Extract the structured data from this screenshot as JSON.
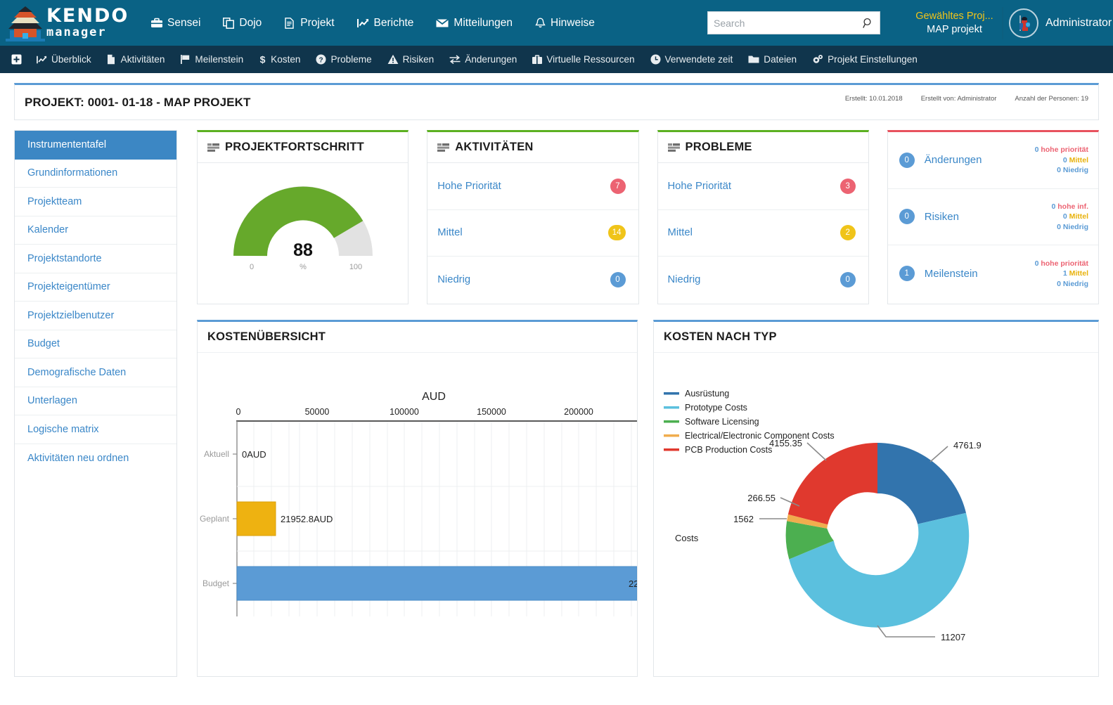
{
  "topbar": {
    "logo": {
      "line1": "KENDO",
      "line2": "manager",
      "icon": "pagoda-logo"
    },
    "nav": [
      {
        "label": "Sensei",
        "icon": "briefcase-icon"
      },
      {
        "label": "Dojo",
        "icon": "copy-icon"
      },
      {
        "label": "Projekt",
        "icon": "file-text-icon"
      },
      {
        "label": "Berichte",
        "icon": "chart-line-icon"
      },
      {
        "label": "Mitteilungen",
        "icon": "envelope-icon"
      },
      {
        "label": "Hinweise",
        "icon": "bell-icon"
      }
    ],
    "search": {
      "value": "",
      "placeholder": "Search",
      "icon": "search-icon"
    },
    "selected_project": {
      "label": "Gewähltes Proj...",
      "value": "MAP projekt"
    },
    "user": {
      "name": "Administrator",
      "avatar": "samurai-avatar"
    }
  },
  "subnav": {
    "plus_icon": "plus-square-icon",
    "items": [
      {
        "label": "Überblick",
        "icon": "chart-line-icon"
      },
      {
        "label": "Aktivitäten",
        "icon": "file-copy-icon"
      },
      {
        "label": "Meilenstein",
        "icon": "flag-icon"
      },
      {
        "label": "Kosten",
        "icon": "dollar-icon"
      },
      {
        "label": "Probleme",
        "icon": "question-circle-icon"
      },
      {
        "label": "Risiken",
        "icon": "warning-triangle-icon"
      },
      {
        "label": "Änderungen",
        "icon": "exchange-icon"
      },
      {
        "label": "Virtuelle Ressourcen",
        "icon": "briefcase-icon"
      },
      {
        "label": "Verwendete zeit",
        "icon": "clock-icon"
      },
      {
        "label": "Dateien",
        "icon": "folder-icon"
      },
      {
        "label": "Projekt Einstellungen",
        "icon": "gears-icon"
      }
    ]
  },
  "project_header": {
    "title": "PROJEKT: 0001- 01-18 - MAP PROJEKT",
    "meta": [
      "Erstellt: 10.01.2018",
      "Erstellt von: Administrator",
      "Anzahl der Personen: 19"
    ]
  },
  "sidebar": {
    "items": [
      {
        "label": "Instrumententafel",
        "active": true
      },
      {
        "label": "Grundinformationen",
        "active": false
      },
      {
        "label": "Projektteam",
        "active": false
      },
      {
        "label": "Kalender",
        "active": false
      },
      {
        "label": "Projektstandorte",
        "active": false
      },
      {
        "label": "Projekteigentümer",
        "active": false
      },
      {
        "label": "Projektzielbenutzer",
        "active": false
      },
      {
        "label": "Budget",
        "active": false
      },
      {
        "label": "Demografische Daten",
        "active": false
      },
      {
        "label": "Unterlagen",
        "active": false
      },
      {
        "label": "Logische matrix",
        "active": false
      },
      {
        "label": "Aktivitäten neu ordnen",
        "active": false
      }
    ]
  },
  "progress_card": {
    "title": "PROJEKTFORTSCHRITT",
    "icon": "list-icon",
    "gauge": {
      "value": 88,
      "min_label": "0",
      "max_label": "100",
      "unit_label": "%"
    }
  },
  "activities_card": {
    "title": "AKTIVITÄTEN",
    "icon": "list-icon",
    "rows": [
      {
        "label": "Hohe Priorität",
        "count": "7",
        "color": "red"
      },
      {
        "label": "Mittel",
        "count": "14",
        "color": "yellow"
      },
      {
        "label": "Niedrig",
        "count": "0",
        "color": "blue"
      }
    ]
  },
  "issues_card": {
    "title": "PROBLEME",
    "icon": "list-icon",
    "rows": [
      {
        "label": "Hohe Priorität",
        "count": "3",
        "color": "red"
      },
      {
        "label": "Mittel",
        "count": "2",
        "color": "yellow"
      },
      {
        "label": "Niedrig",
        "count": "0",
        "color": "blue"
      }
    ]
  },
  "summary_card": {
    "rows": [
      {
        "count": "0",
        "name": "Änderungen",
        "stats": [
          {
            "num": "0",
            "text": "hohe priorität",
            "level": "high"
          },
          {
            "num": "0",
            "text": "Mittel",
            "level": "mid"
          },
          {
            "num": "0",
            "text": "Niedrig",
            "level": "low"
          }
        ]
      },
      {
        "count": "0",
        "name": "Risiken",
        "stats": [
          {
            "num": "0",
            "text": "hohe inf.",
            "level": "high"
          },
          {
            "num": "0",
            "text": "Mittel",
            "level": "mid"
          },
          {
            "num": "0",
            "text": "Niedrig",
            "level": "low"
          }
        ]
      },
      {
        "count": "1",
        "name": "Meilenstein",
        "stats": [
          {
            "num": "0",
            "text": "hohe priorität",
            "level": "high"
          },
          {
            "num": "1",
            "text": "Mittel",
            "level": "mid"
          },
          {
            "num": "0",
            "text": "Niedrig",
            "level": "low"
          }
        ]
      }
    ]
  },
  "cost_card": {
    "title": "KOSTENÜBERSICHT"
  },
  "type_card": {
    "title": "KOSTEN NACH TYP"
  },
  "chart_data": [
    {
      "type": "bar",
      "orientation": "horizontal",
      "title": "KOSTENÜBERSICHT",
      "xlabel": "AUD",
      "ylabel": "",
      "categories": [
        "Aktuell",
        "Geplant",
        "Budget"
      ],
      "values": [
        0,
        21952.8,
        224000
      ],
      "data_labels": [
        "0AUD",
        "21952.8AUD",
        "22"
      ],
      "colors": [
        "#f0b400",
        "#f0b400",
        "#5b9bd5"
      ],
      "xlim": [
        0,
        224000
      ],
      "xticks": [
        0,
        50000,
        100000,
        150000,
        200000
      ],
      "xtick_labels": [
        "0",
        "50000",
        "100000",
        "150000",
        "200000"
      ],
      "grid": true,
      "note": "Budget bar is clipped at the panel edge; its label is truncated to '22'"
    },
    {
      "type": "pie",
      "variant": "donut",
      "title": "KOSTEN NACH TYP",
      "axis_label": "Costs",
      "labels": [
        "Ausrüstung",
        "Prototype Costs",
        "Software Licensing",
        "Electrical/Electronic Component Costs",
        "PCB Production Costs"
      ],
      "values": [
        4761.9,
        11207,
        1562,
        266.55,
        4155.35
      ],
      "value_labels": [
        "4761.9",
        "11207",
        "1562",
        "266.55",
        "4155.35"
      ],
      "colors": [
        "#3274ad",
        "#5bc0de",
        "#4caf50",
        "#f0ad4e",
        "#e0392e"
      ],
      "legend": "left",
      "grid": false
    }
  ],
  "colors": {
    "brand_blue": "#0a6285",
    "subnav_dark": "#10354c",
    "accent_yellow": "#f0c419",
    "link_blue": "#3a87c8",
    "green": "#5cb021",
    "red": "#e8525e"
  }
}
